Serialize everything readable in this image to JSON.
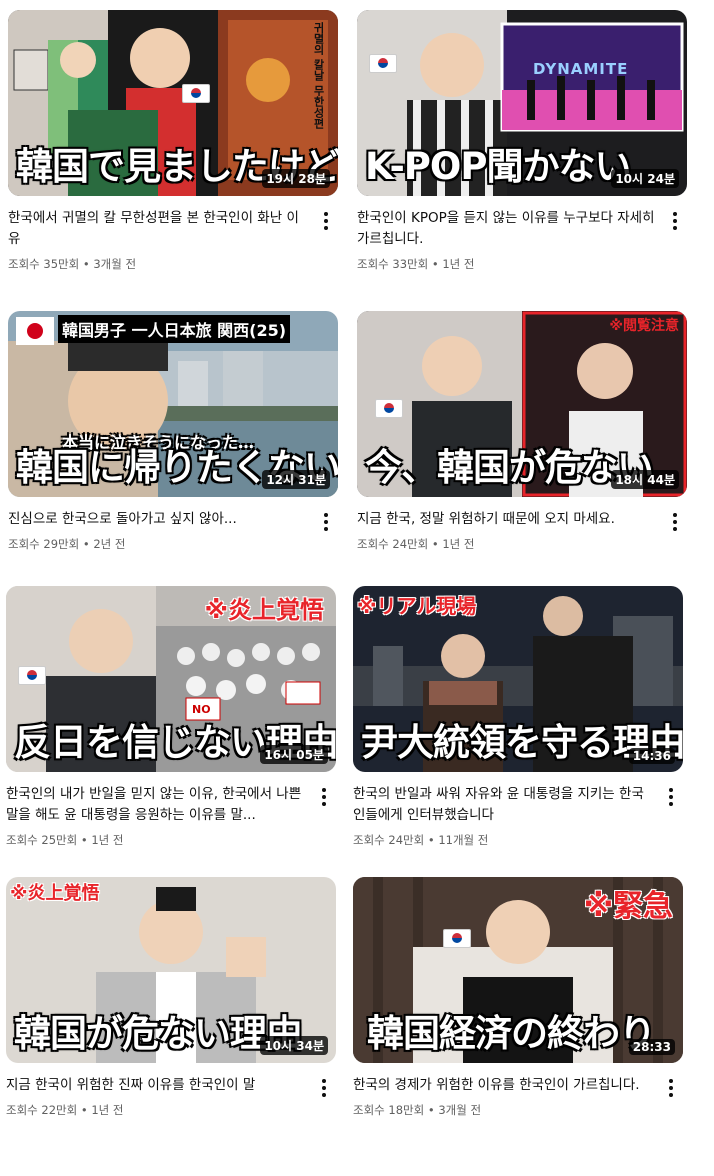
{
  "videos": [
    {
      "overlay": "韓国で見ましたけど",
      "duration": "19시 28분",
      "title": "한국에서 귀멸의 칼 무한성편을 본 한국인이 화난 이유",
      "views": "조회수 35만회",
      "age": "3개월 전",
      "poster_text": "귀멸의 칼날 무한성편"
    },
    {
      "overlay": "K-POP聞かない",
      "duration": "10시 24분",
      "title": "한국인이 KPOP을 듣지 않는 이유를 누구보다 자세히 가르칩니다.",
      "views": "조회수 33만회",
      "age": "1년 전",
      "poster_text": "DYNAMITE"
    },
    {
      "overlay": "韓国に帰りたくない",
      "subtitle": "本当に泣きそうになった…",
      "banner": "韓国男子 一人日本旅 関西(25)",
      "duration": "12시 31분",
      "title": "진심으로 한국으로 돌아가고 싶지 않아...",
      "views": "조회수 29만회",
      "age": "2년 전"
    },
    {
      "overlay": "今、韓国が危ない",
      "tag": "※閲覧注意",
      "duration": "18시 44분",
      "title": "지금 한국, 정말 위험하기 때문에 오지 마세요.",
      "views": "조회수 24만회",
      "age": "1년 전"
    },
    {
      "overlay": "反日を信じない理由",
      "tag": "※炎上覚悟",
      "duration": "16시 05분",
      "title": "한국인의 내가 반일을 믿지 않는 이유, 한국에서 나쁜 말을 해도 윤 대통령을 응원하는 이유를 말...",
      "views": "조회수 25만회",
      "age": "1년 전",
      "sign_text": "NO"
    },
    {
      "overlay": "尹大統領を守る理由",
      "tag": "※リアル現場",
      "duration": "14:36",
      "title": "한국의 반일과 싸워 자유와 윤 대통령을 지키는 한국인들에게 인터뷰했습니다",
      "views": "조회수 24만회",
      "age": "11개월 전"
    },
    {
      "overlay": "韓国が危ない理由",
      "tag": "※炎上覚悟",
      "duration": "10시 34분",
      "title": "지금 한국이 위험한 진짜 이유를 한국인이 말",
      "views": "조회수 22만회",
      "age": "1년 전"
    },
    {
      "overlay": "韓国経済の終わり",
      "tag": "※緊急",
      "duration": "28:33",
      "title": "한국의 경제가 위험한 이유를 한국인이 가르칩니다.",
      "views": "조회수 18만회",
      "age": "3개월 전"
    }
  ],
  "separator": "•",
  "colors": {
    "title": "#0f0f0f",
    "meta": "#606060",
    "tag_red": "#e8242a",
    "tag_white": "#ffffff"
  },
  "icons": {
    "more": "more-vert-icon",
    "flag": "korea-flag-icon",
    "jp_flag": "japan-flag-icon"
  }
}
